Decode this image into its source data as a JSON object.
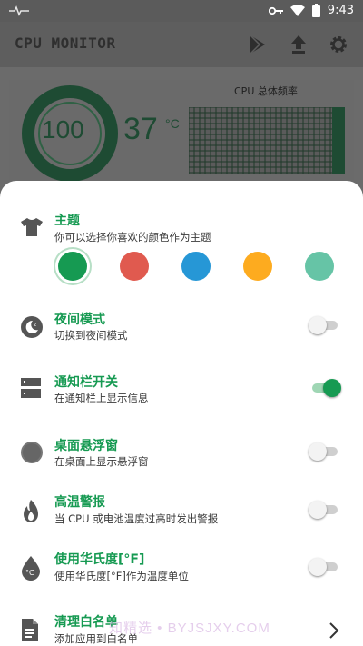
{
  "status_bar": {
    "time": "9:43"
  },
  "app": {
    "title": "CPU MONITOR"
  },
  "dashboard": {
    "usage_value": "100",
    "temperature_value": "37",
    "temperature_unit": "°C",
    "freq_label": "CPU 总体频率"
  },
  "theme": {
    "title": "主题",
    "subtitle": "你可以选择你喜欢的颜色作为主题",
    "colors": [
      "#169a52",
      "#e05a4f",
      "#2697d6",
      "#fdab1f",
      "#66c4a6"
    ],
    "selected_index": 0
  },
  "settings": [
    {
      "title": "夜间模式",
      "subtitle": "切换到夜间模式",
      "enabled": false
    },
    {
      "title": "通知栏开关",
      "subtitle": "在通知栏上显示信息",
      "enabled": true
    },
    {
      "title": "桌面悬浮窗",
      "subtitle": "在桌面上显示悬浮窗",
      "enabled": false
    },
    {
      "title": "高温警报",
      "subtitle": "当 CPU 或电池温度过高时发出警报",
      "enabled": false
    },
    {
      "title": "使用华氏度[°F]",
      "subtitle": "使用华氏度[°F]作为温度单位",
      "enabled": false
    },
    {
      "title": "清理白名单",
      "subtitle": "添加应用到白名单"
    }
  ],
  "watermark": "知精选 • BYJSJXY.COM"
}
